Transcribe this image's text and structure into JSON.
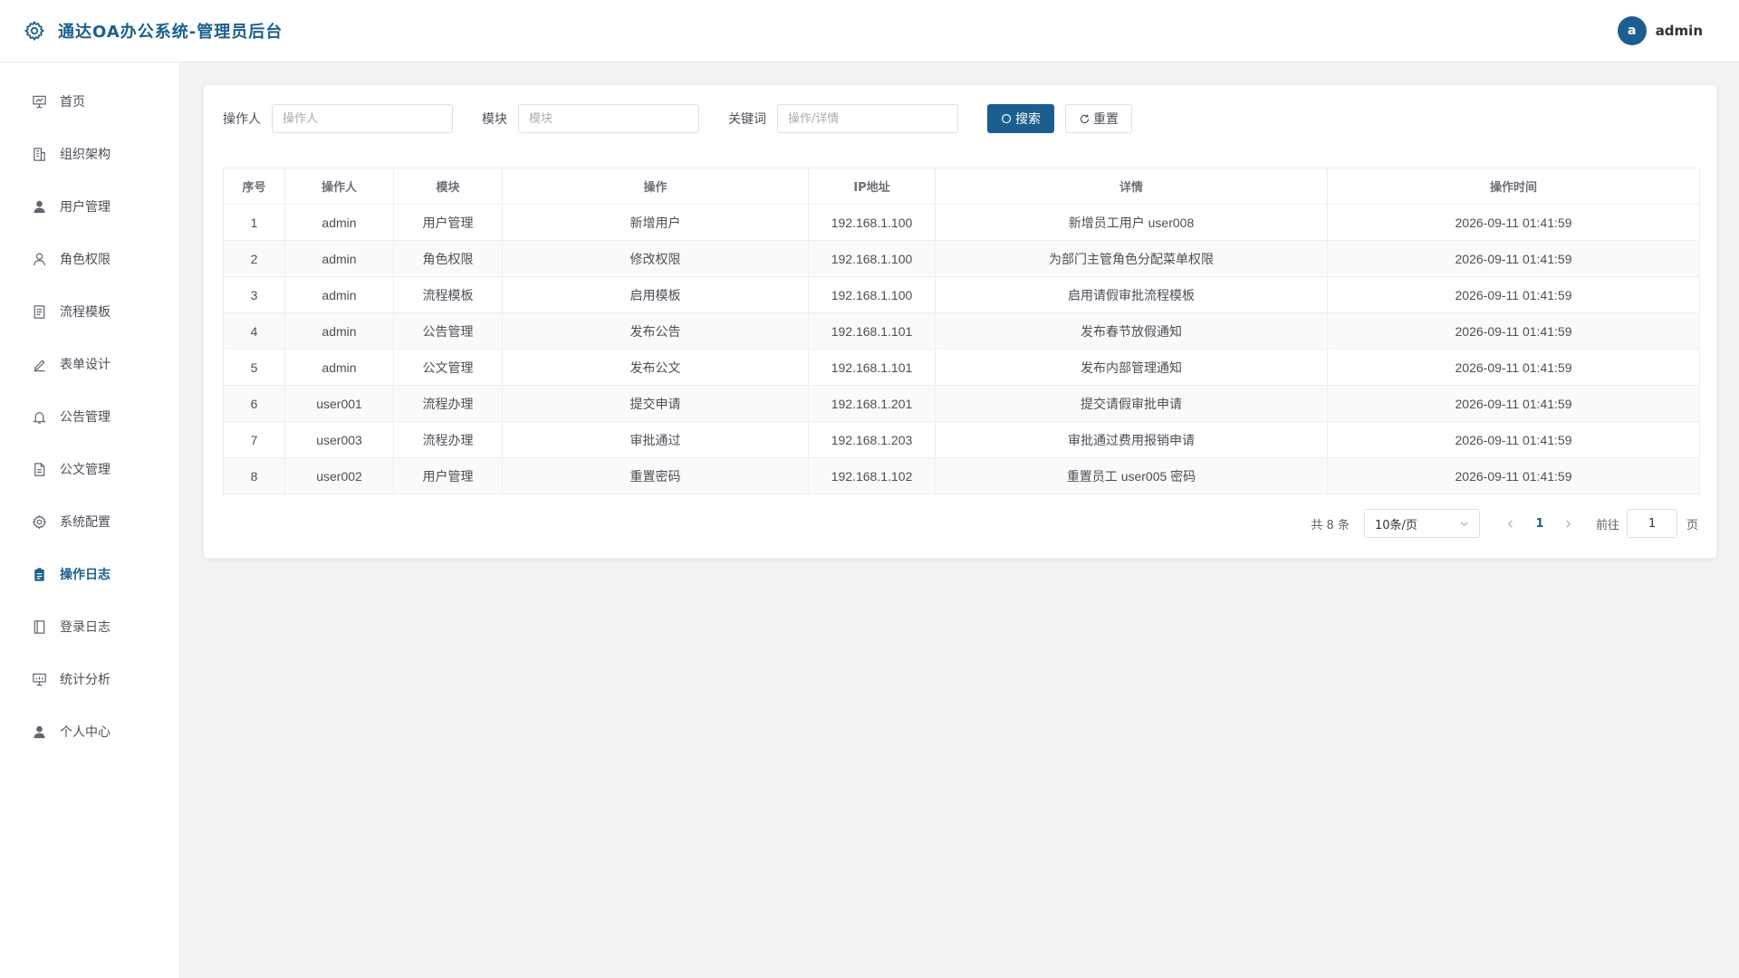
{
  "app": {
    "title": "通达OA办公系统-管理员后台",
    "accent_color": "#1a5f8f",
    "user_initial": "a",
    "username": "admin"
  },
  "sidebar": {
    "items": [
      {
        "label": "首页",
        "icon": "dashboard-icon",
        "active": false
      },
      {
        "label": "组织架构",
        "icon": "building-icon",
        "active": false
      },
      {
        "label": "用户管理",
        "icon": "user-filled-icon",
        "active": false
      },
      {
        "label": "角色权限",
        "icon": "user-outline-icon",
        "active": false
      },
      {
        "label": "流程模板",
        "icon": "document-icon",
        "active": false
      },
      {
        "label": "表单设计",
        "icon": "edit-pen-icon",
        "active": false
      },
      {
        "label": "公告管理",
        "icon": "bell-icon",
        "active": false
      },
      {
        "label": "公文管理",
        "icon": "file-icon",
        "active": false
      },
      {
        "label": "系统配置",
        "icon": "gear-icon",
        "active": false
      },
      {
        "label": "操作日志",
        "icon": "clipboard-icon",
        "active": true
      },
      {
        "label": "登录日志",
        "icon": "notebook-icon",
        "active": false
      },
      {
        "label": "统计分析",
        "icon": "presentation-chart-icon",
        "active": false
      },
      {
        "label": "个人中心",
        "icon": "user-filled-icon",
        "active": false
      }
    ]
  },
  "filters": {
    "operator_label": "操作人",
    "operator_placeholder": "操作人",
    "module_label": "模块",
    "module_placeholder": "模块",
    "keyword_label": "关键词",
    "keyword_placeholder": "操作/详情",
    "search_label": "搜索",
    "reset_label": "重置"
  },
  "table": {
    "columns": [
      "序号",
      "操作人",
      "模块",
      "操作",
      "IP地址",
      "详情",
      "操作时间"
    ],
    "rows": [
      [
        "1",
        "admin",
        "用户管理",
        "新增用户",
        "192.168.1.100",
        "新增员工用户 user008",
        "2026-09-11 01:41:59"
      ],
      [
        "2",
        "admin",
        "角色权限",
        "修改权限",
        "192.168.1.100",
        "为部门主管角色分配菜单权限",
        "2026-09-11 01:41:59"
      ],
      [
        "3",
        "admin",
        "流程模板",
        "启用模板",
        "192.168.1.100",
        "启用请假审批流程模板",
        "2026-09-11 01:41:59"
      ],
      [
        "4",
        "admin",
        "公告管理",
        "发布公告",
        "192.168.1.101",
        "发布春节放假通知",
        "2026-09-11 01:41:59"
      ],
      [
        "5",
        "admin",
        "公文管理",
        "发布公文",
        "192.168.1.101",
        "发布内部管理通知",
        "2026-09-11 01:41:59"
      ],
      [
        "6",
        "user001",
        "流程办理",
        "提交申请",
        "192.168.1.201",
        "提交请假审批申请",
        "2026-09-11 01:41:59"
      ],
      [
        "7",
        "user003",
        "流程办理",
        "审批通过",
        "192.168.1.203",
        "审批通过费用报销申请",
        "2026-09-11 01:41:59"
      ],
      [
        "8",
        "user002",
        "用户管理",
        "重置密码",
        "192.168.1.102",
        "重置员工 user005 密码",
        "2026-09-11 01:41:59"
      ]
    ]
  },
  "pagination": {
    "total_text": "共 8 条",
    "page_size": "10条/页",
    "current_page": "1",
    "goto_label": "前往",
    "goto_value": "1",
    "goto_suffix": "页"
  }
}
